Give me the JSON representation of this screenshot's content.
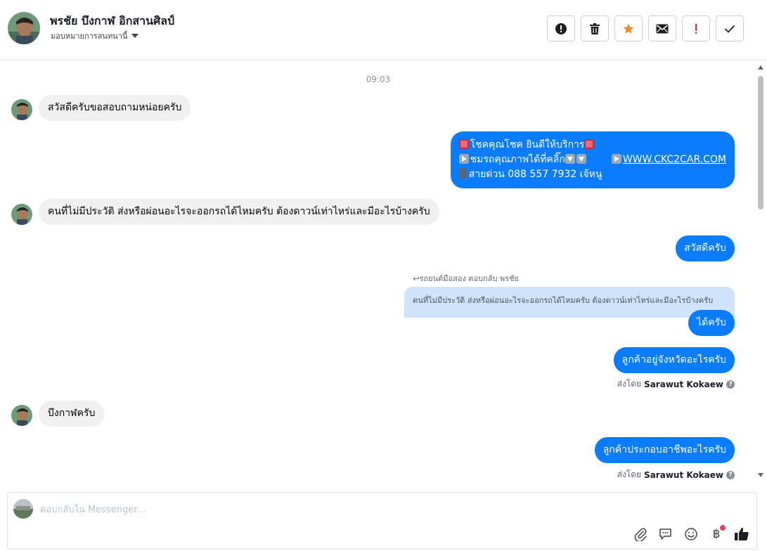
{
  "header": {
    "contact_name": "พรชัย บึงกาฬ อิกสานศิลป์",
    "assign_label": "มอบหมายการสนทนานี้",
    "actions": [
      {
        "name": "spam-button",
        "icon": "exclamation-circle-icon"
      },
      {
        "name": "delete-button",
        "icon": "trash-icon"
      },
      {
        "name": "star-button",
        "icon": "star-icon",
        "color": "#f28b30"
      },
      {
        "name": "mark-unread-button",
        "icon": "envelope-icon"
      },
      {
        "name": "follow-up-button",
        "icon": "exclamation-icon",
        "color": "#e4233f"
      },
      {
        "name": "done-button",
        "icon": "check-icon"
      }
    ]
  },
  "thread": {
    "timestamp": "09:03",
    "messages": {
      "m1": "สวัสดีครับขอสอบถามหน่อยครับ",
      "m2": {
        "line1": "โชคคุณโชค ยินดีให้บริการ",
        "line2_text": "ชมรถคุณภาพได้ที่คลิ๊ก",
        "line2_link": "WWW.CKC2CAR.COM",
        "line3": "สายด่วน 088 557 7932 เจ้หนู"
      },
      "m3": "คนที่ไม่มีประวัติ ส่งหรือผ่อนอะไรจะออกรถได้ไหมครับ ต้องดาวน์เท่าไหร่และมีอะไรบ้างครับ",
      "m4": "สวัสดีครับ",
      "m5_reply_meta": "รถยนต์มือสอง ตอบกลับ พรชัย",
      "m5_quoted": "คนที่ไม่มีประวัติ ส่งหรือผ่อนอะไรจะออกรถได้ไหมครับ ต้องดาวน์เท่าไหร่และมีอะไรบ้างครับ",
      "m5": "ได้ครับ",
      "m6": "ลูกค้าอยู่จังหวัดอะไรครับ",
      "m7": "บึงกาฬครับ",
      "m8": "ลูกค้าประกอบอาชีพอะไรครับ"
    },
    "sent_by_prefix": "ส่งโดย",
    "sent_by_name": "Sarawut Kokaew",
    "help_glyph": "?"
  },
  "composer": {
    "placeholder": "ตอบกลับใน Messenger...",
    "value": "",
    "baht_glyph": "฿",
    "accent_color": "#0a7cff"
  }
}
